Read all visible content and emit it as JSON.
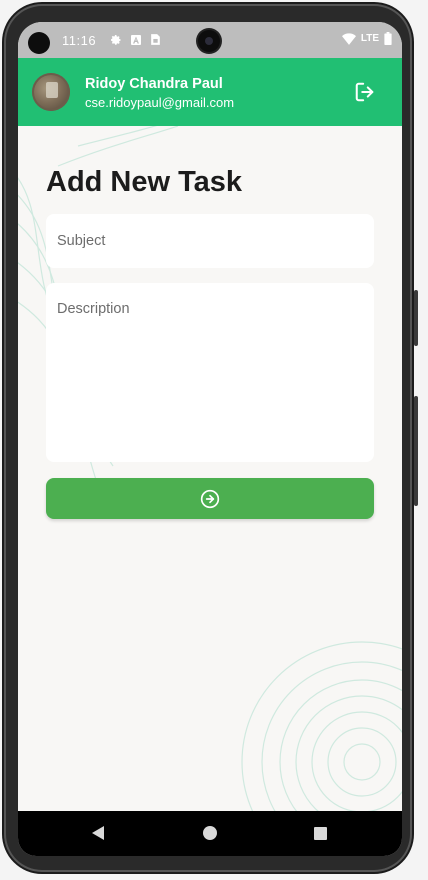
{
  "status_bar": {
    "time": "11:16",
    "network_label": "LTE",
    "icons": [
      "gear-icon",
      "a-icon",
      "sim-card-icon",
      "wifi-icon",
      "battery-icon"
    ]
  },
  "header": {
    "user_name": "Ridoy Chandra Paul",
    "user_email": "cse.ridoypaul@gmail.com",
    "background_color": "#21bf73",
    "logout_icon": "logout-icon"
  },
  "form": {
    "title": "Add New Task",
    "subject": {
      "placeholder": "Subject",
      "value": ""
    },
    "description": {
      "placeholder": "Description",
      "value": ""
    },
    "submit_icon": "arrow-circle-right-icon",
    "submit_color": "#4caf50"
  },
  "nav_bar": {
    "icons": [
      "back-icon",
      "home-icon",
      "recents-icon"
    ]
  }
}
